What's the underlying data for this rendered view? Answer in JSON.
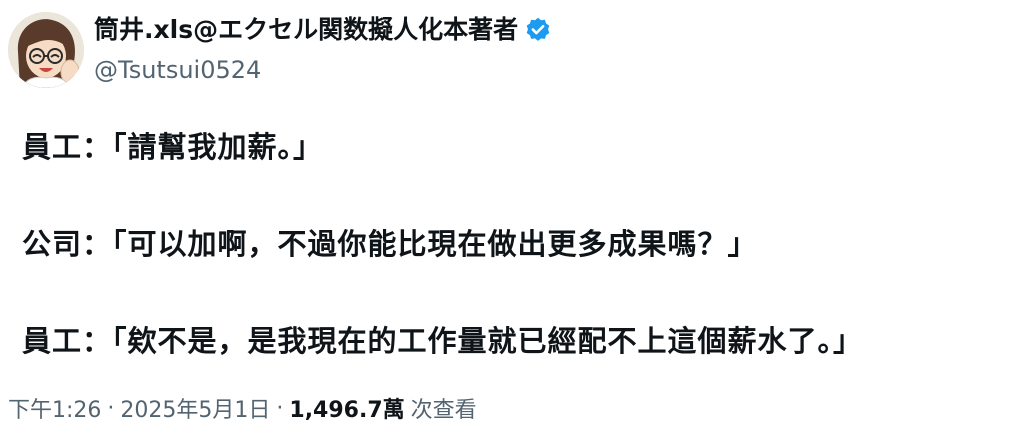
{
  "author": {
    "display_name": "筒井.xls@エクセル関数擬人化本著者",
    "handle": "@Tsutsui0524",
    "verified": true,
    "avatar_icon": "illustrated-portrait-avatar",
    "verified_icon": "verified-badge-icon"
  },
  "tweet": {
    "lines": [
      "員工：「請幫我加薪。」",
      "公司：「可以加啊，不過你能比現在做出更多成果嗎？」",
      "員工：「欸不是，是我現在的工作量就已經配不上這個薪水了。」"
    ],
    "time": "下午1:26",
    "date": "2025年5月1日",
    "separator": "·",
    "views_count": "1,496.7萬",
    "views_label": "次查看"
  },
  "colors": {
    "text_primary": "#0f1419",
    "text_secondary": "#536471",
    "verified_blue": "#1d9bf0",
    "background": "#ffffff"
  }
}
